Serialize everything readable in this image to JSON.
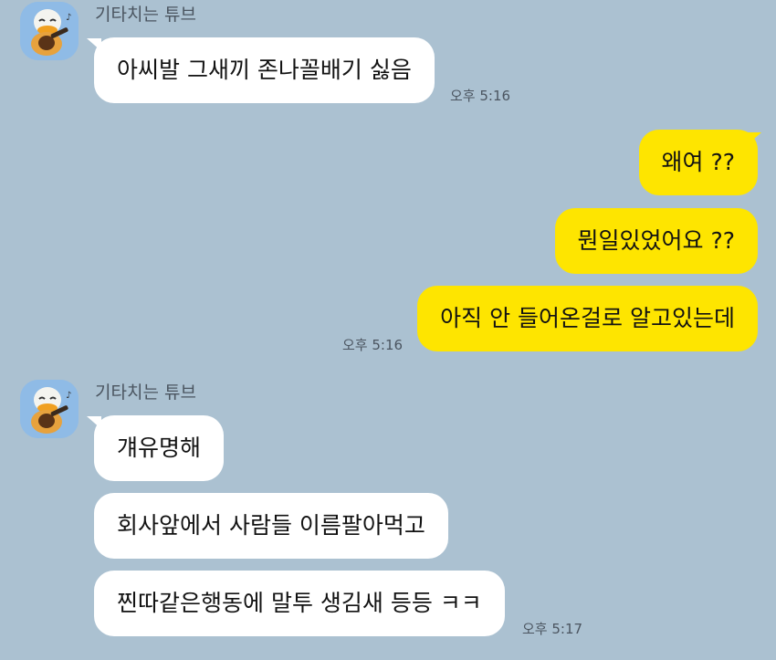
{
  "colors": {
    "background": "#abc1d1",
    "incoming_bubble": "#ffffff",
    "outgoing_bubble": "#fee500",
    "avatar_background": "#8fbbe6"
  },
  "groups": [
    {
      "sender": "기타치는 튜브",
      "avatar_icon": "tube-guitar-character-icon",
      "messages": [
        "아씨발 그새끼 존나꼴배기 싫음"
      ],
      "time": "오후 5:16"
    },
    {
      "sender": "me",
      "messages": [
        "왜여 ??",
        "뭔일있었어요 ??",
        "아직 안 들어온걸로 알고있는데"
      ],
      "time": "오후 5:16"
    },
    {
      "sender": "기타치는 튜브",
      "avatar_icon": "tube-guitar-character-icon",
      "messages": [
        "걔유명해",
        "회사앞에서 사람들 이름팔아먹고",
        "찐따같은행동에 말투 생김새 등등 ㅋㅋ"
      ],
      "time": "오후 5:17"
    }
  ]
}
